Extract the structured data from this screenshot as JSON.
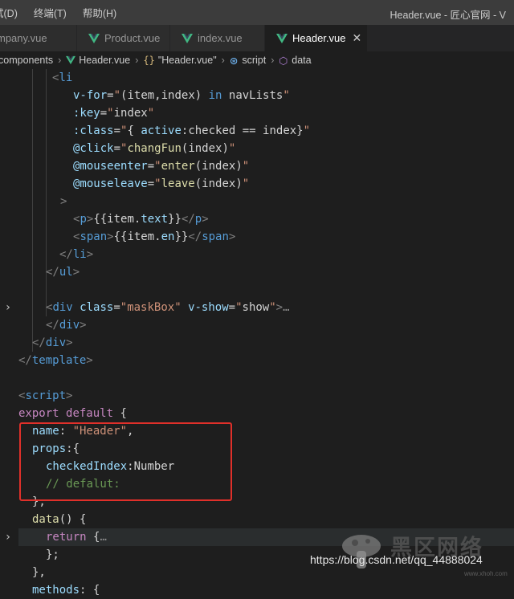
{
  "menu": [
    "试(D)",
    "终端(T)",
    "帮助(H)"
  ],
  "window_title": "Header.vue - 匠心官网 - V",
  "tabs": [
    {
      "label": "mpany.vue",
      "active": false
    },
    {
      "label": "Product.vue",
      "active": false
    },
    {
      "label": "index.vue",
      "active": false
    },
    {
      "label": "Header.vue",
      "active": true
    }
  ],
  "breadcrumb": {
    "folder": "components",
    "file": "Header.vue",
    "component": "\"Header.vue\"",
    "component_glyph": "{}",
    "script": "script",
    "data": "data"
  },
  "code_lines": [
    "        <li",
    "          v-for=\"(item,index) in navLists\"",
    "          :key=\"index\"",
    "          :class=\"{ active:checked == index}\"",
    "          @click=\"changFun(index)\"",
    "          @mouseenter=\"enter(index)\"",
    "          @mouseleave=\"leave(index)\"",
    "        >",
    "          <p>{{item.text}}</p>",
    "          <span>{{item.en}}</span>",
    "        </li>",
    "      </ul>",
    "",
    "      <div class=\"maskBox\" v-show=\"show\">…",
    "      </div>",
    "    </div>",
    "</template>",
    "",
    "<script>",
    "export default {",
    "  name: \"Header\",",
    "  props:{",
    "    checkedIndex:Number",
    "    // defalut:",
    "  },",
    "  data() {",
    "    return {…",
    "    };",
    "  },",
    "  methods: {"
  ],
  "colors": {
    "accent_red_box": "#e0302a",
    "vue_green": "#41b883",
    "editor_bg": "#1e1e1e"
  },
  "icons": {
    "tab_icon": "vue-icon",
    "fold": "chevron-right-icon",
    "close": "close-icon",
    "watermark": "mushroom-logo-icon"
  },
  "watermark": {
    "brand": "黑区网络",
    "url": "https://blog.csdn.net/qq_44888024",
    "sub": "www.xhoh.com"
  }
}
